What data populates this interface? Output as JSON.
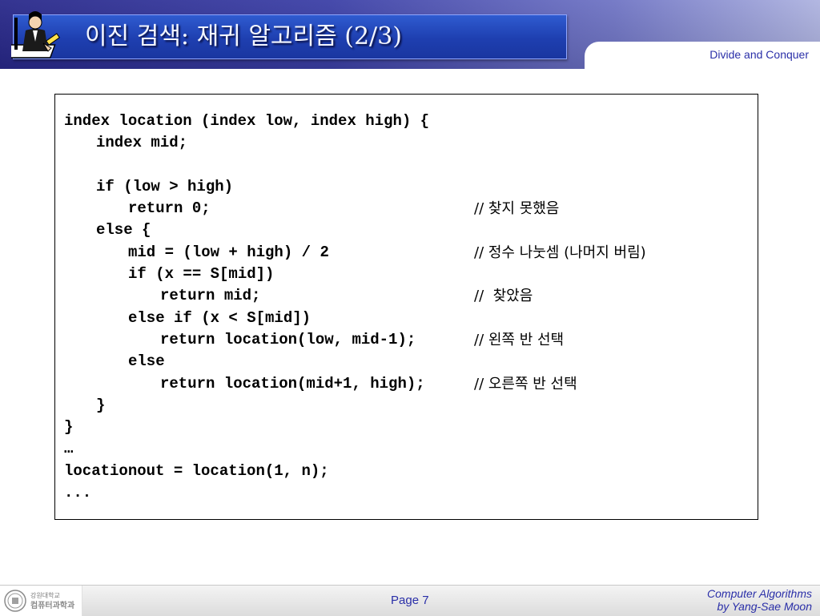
{
  "header": {
    "title": "이진 검색: 재귀 알고리즘 (2/3)",
    "tag": "Divide and Conquer",
    "logo_icon": "person-writing-icon"
  },
  "code": {
    "lines": [
      {
        "indent": 0,
        "text": "index location (index low, index high) {",
        "comment": ""
      },
      {
        "indent": 1,
        "text": "index mid;",
        "comment": ""
      },
      {
        "indent": 0,
        "text": "",
        "comment": ""
      },
      {
        "indent": 1,
        "text": "if (low > high)",
        "comment": ""
      },
      {
        "indent": 2,
        "text": "return 0;",
        "comment": "// 찾지 못했음"
      },
      {
        "indent": 1,
        "text": "else {",
        "comment": ""
      },
      {
        "indent": 2,
        "text": "mid = (low + high) / 2",
        "comment": "// 정수 나눗셈 (나머지 버림)"
      },
      {
        "indent": 2,
        "text": "if (x == S[mid])",
        "comment": ""
      },
      {
        "indent": 3,
        "text": "return mid;",
        "comment": "//  찾았음"
      },
      {
        "indent": 2,
        "text": "else if (x < S[mid])",
        "comment": ""
      },
      {
        "indent": 3,
        "text": "return location(low, mid-1);",
        "comment": "// 왼쪽 반 선택"
      },
      {
        "indent": 2,
        "text": "else",
        "comment": ""
      },
      {
        "indent": 3,
        "text": "return location(mid+1, high);",
        "comment": "// 오른쪽 반 선택"
      },
      {
        "indent": 1,
        "text": "}",
        "comment": ""
      },
      {
        "indent": 0,
        "text": "}",
        "comment": ""
      },
      {
        "indent": 0,
        "text": "…",
        "comment": ""
      },
      {
        "indent": 0,
        "text": "locationout = location(1, n);",
        "comment": ""
      },
      {
        "indent": 0,
        "text": "...",
        "comment": ""
      }
    ]
  },
  "footer": {
    "university": "강원대학교",
    "department": "컴퓨터과학과",
    "page": "Page 7",
    "credit_line1": "Computer Algorithms",
    "credit_line2": "by Yang-Sae Moon",
    "seal_icon": "university-seal-icon"
  }
}
